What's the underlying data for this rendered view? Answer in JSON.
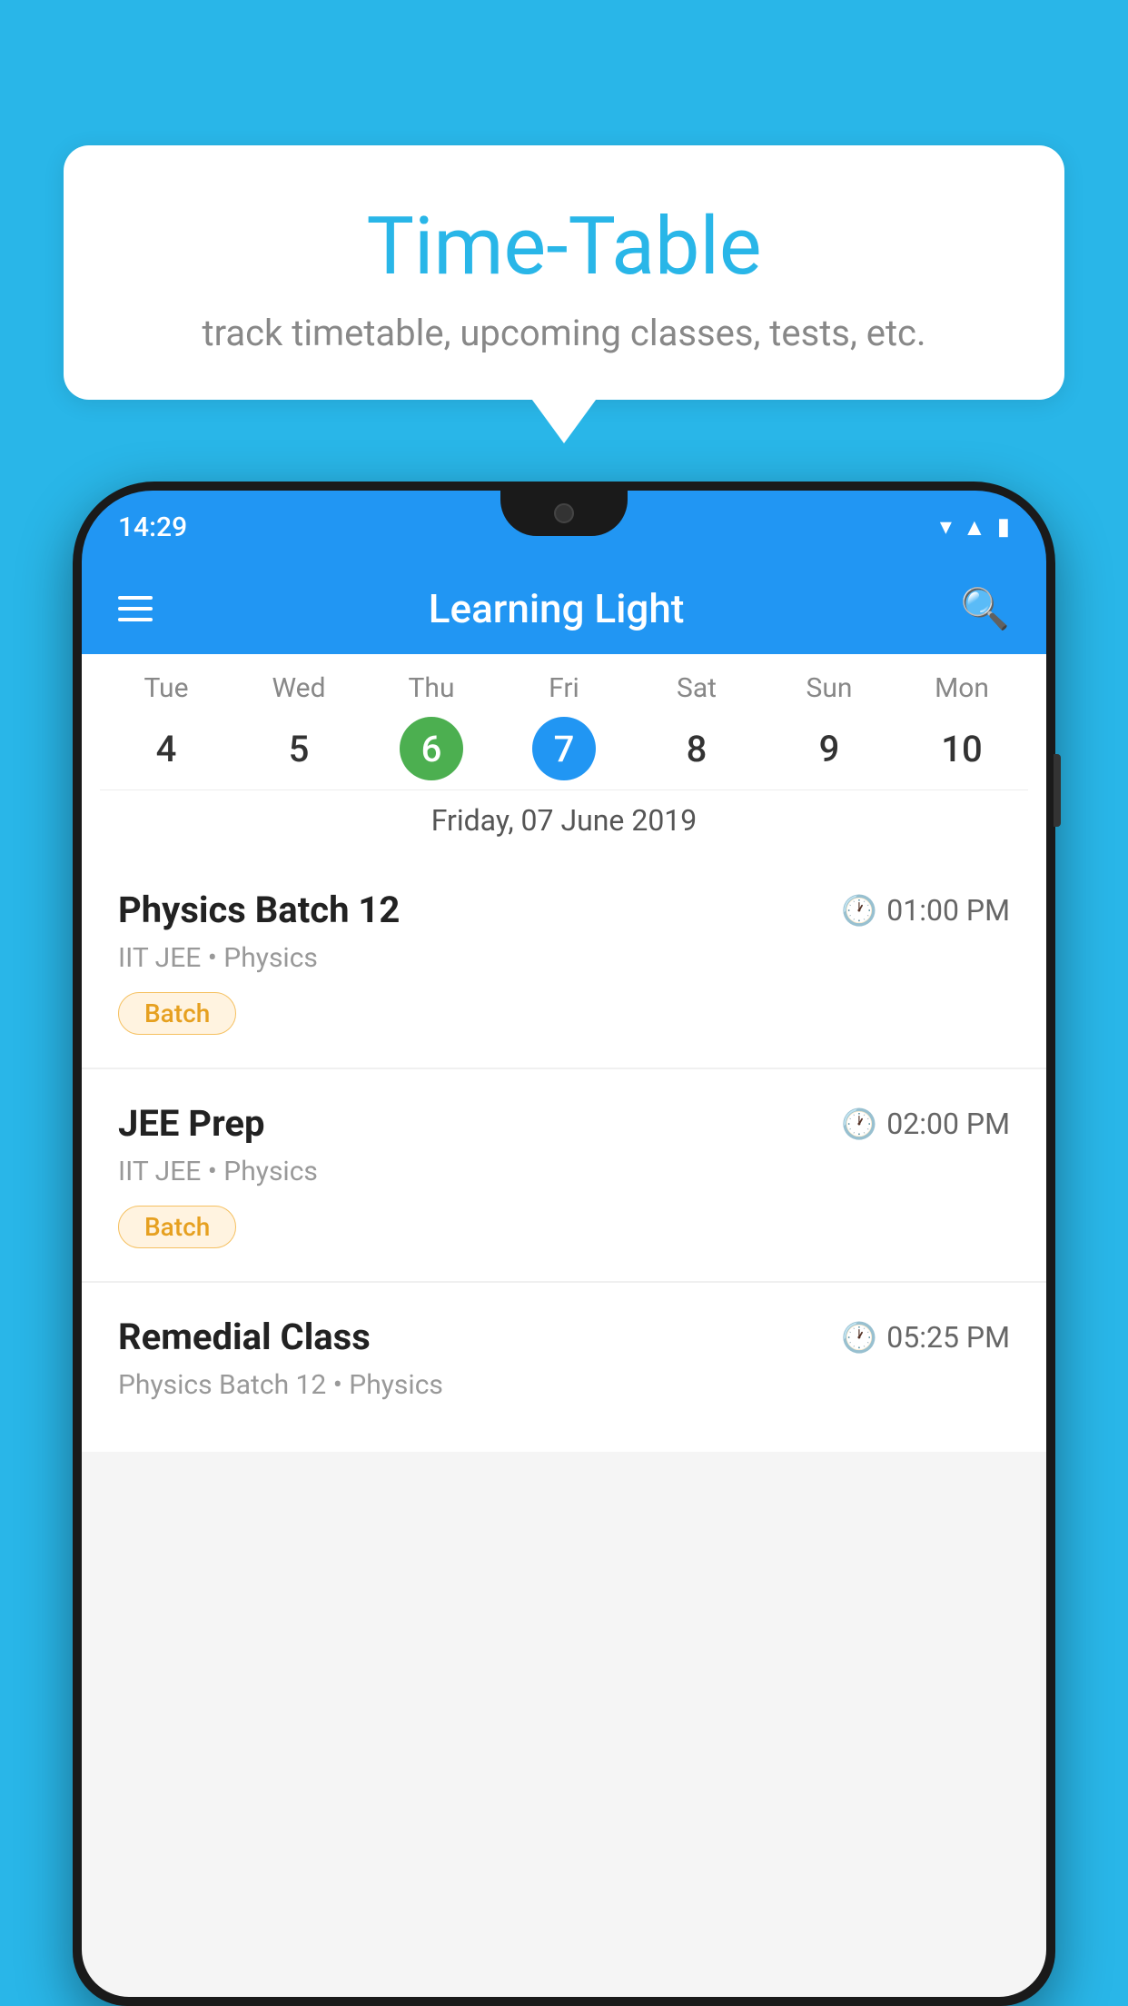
{
  "background_color": "#29b6e8",
  "tooltip": {
    "title": "Time-Table",
    "subtitle": "track timetable, upcoming classes, tests, etc."
  },
  "phone": {
    "status_time": "14:29",
    "app_title": "Learning Light",
    "calendar": {
      "days": [
        {
          "name": "Tue",
          "num": "4",
          "state": "normal"
        },
        {
          "name": "Wed",
          "num": "5",
          "state": "normal"
        },
        {
          "name": "Thu",
          "num": "6",
          "state": "today"
        },
        {
          "name": "Fri",
          "num": "7",
          "state": "selected"
        },
        {
          "name": "Sat",
          "num": "8",
          "state": "normal"
        },
        {
          "name": "Sun",
          "num": "9",
          "state": "normal"
        },
        {
          "name": "Mon",
          "num": "10",
          "state": "normal"
        }
      ],
      "selected_date_label": "Friday, 07 June 2019"
    },
    "schedule": [
      {
        "title": "Physics Batch 12",
        "time": "01:00 PM",
        "meta": "IIT JEE • Physics",
        "badge": "Batch"
      },
      {
        "title": "JEE Prep",
        "time": "02:00 PM",
        "meta": "IIT JEE • Physics",
        "badge": "Batch"
      },
      {
        "title": "Remedial Class",
        "time": "05:25 PM",
        "meta": "Physics Batch 12 • Physics",
        "badge": null
      }
    ]
  }
}
